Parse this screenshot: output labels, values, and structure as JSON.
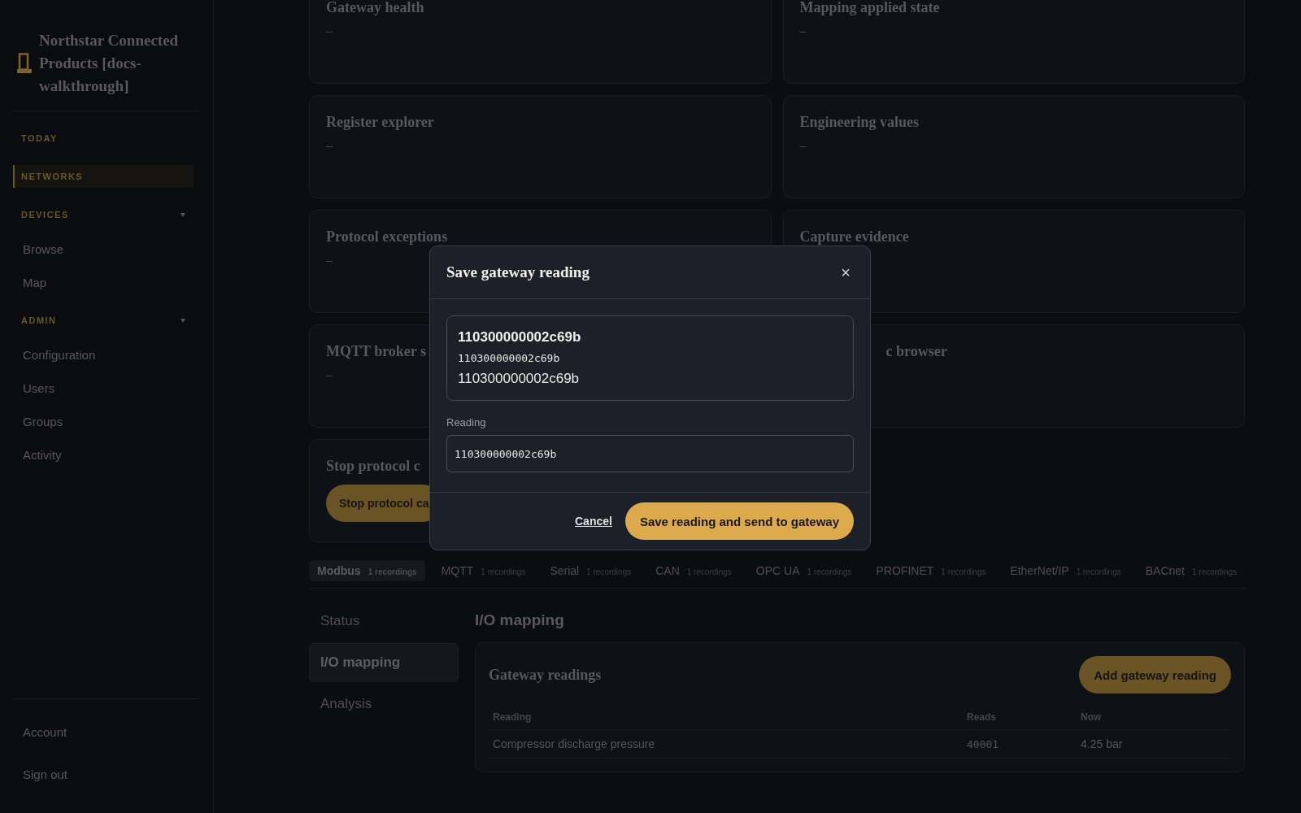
{
  "sidebar": {
    "brand": "Northstar Connected Products [docs-walkthrough]",
    "sections": [
      {
        "kind": "link",
        "label": "TODAY",
        "selected": false
      },
      {
        "kind": "link",
        "label": "NETWORKS",
        "selected": true
      },
      {
        "kind": "group",
        "label": "DEVICES",
        "expanded": true,
        "items": [
          {
            "label": "Browse"
          },
          {
            "label": "Map"
          }
        ]
      },
      {
        "kind": "group",
        "label": "ADMIN",
        "expanded": true,
        "items": [
          {
            "label": "Configuration"
          },
          {
            "label": "Users"
          },
          {
            "label": "Groups"
          },
          {
            "label": "Activity"
          }
        ]
      }
    ],
    "footer": [
      {
        "label": "Account"
      },
      {
        "label": "Sign out"
      }
    ]
  },
  "cards": [
    {
      "title": "Gateway health",
      "value": "–"
    },
    {
      "title": "Mapping applied state",
      "value": "–"
    },
    {
      "title": "Register explorer",
      "value": "–"
    },
    {
      "title": "Engineering values",
      "value": "–"
    },
    {
      "title": "Protocol exceptions",
      "value": "–"
    },
    {
      "title": "Capture evidence"
    },
    {
      "title": "MQTT broker s",
      "value": "–"
    },
    {
      "title": "c browser",
      "cut_left": true
    },
    {
      "title": "Stop protocol c",
      "button": "Stop protocol ca"
    }
  ],
  "protocol_tabs": [
    {
      "label": "Modbus",
      "count": "1 recordings",
      "selected": true
    },
    {
      "label": "MQTT",
      "count": "1 recordings",
      "selected": false
    },
    {
      "label": "Serial",
      "count": "1 recordings",
      "selected": false
    },
    {
      "label": "CAN",
      "count": "1 recordings",
      "selected": false
    },
    {
      "label": "OPC UA",
      "count": "1 recordings",
      "selected": false
    },
    {
      "label": "PROFINET",
      "count": "1 recordings",
      "selected": false
    },
    {
      "label": "EtherNet/IP",
      "count": "1 recordings",
      "selected": false
    },
    {
      "label": "BACnet",
      "count": "1 recordings",
      "selected": false
    }
  ],
  "subnav": [
    {
      "label": "Status",
      "selected": false
    },
    {
      "label": "I/O mapping",
      "selected": true
    },
    {
      "label": "Analysis",
      "selected": false
    }
  ],
  "section": {
    "heading": "I/O mapping",
    "panel_title": "Gateway readings",
    "add_button": "Add gateway reading",
    "table": {
      "columns": [
        "Reading",
        "Reads",
        "Now"
      ],
      "rows": [
        [
          "Compressor discharge pressure",
          "40001",
          "4.25 bar"
        ]
      ]
    }
  },
  "modal": {
    "title": "Save gateway reading",
    "close": "×",
    "preview": [
      "110300000002c69b",
      "110300000002c69b",
      "110300000002c69b"
    ],
    "field_label": "Reading",
    "field_value": "110300000002c69b",
    "cancel": "Cancel",
    "submit": "Save reading and send to gateway"
  }
}
